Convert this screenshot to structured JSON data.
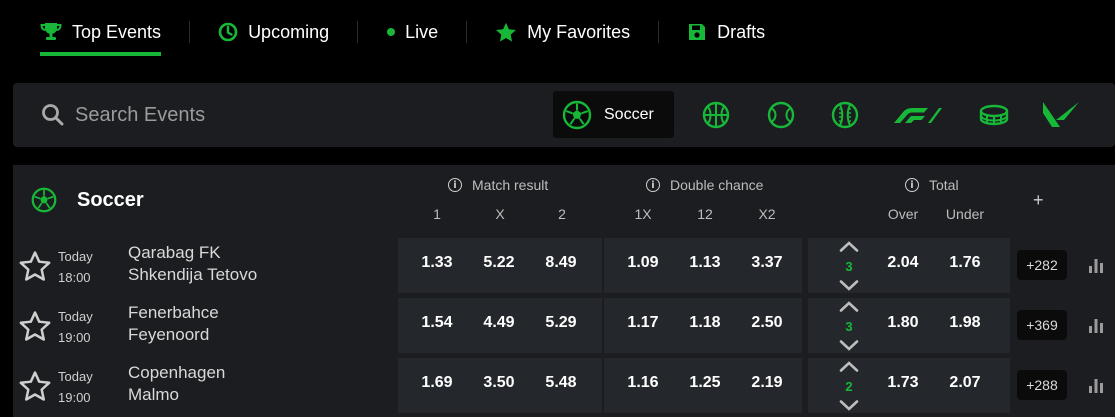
{
  "colors": {
    "accent": "#17b737",
    "panel": "#1b1d20",
    "odds_cell": "#24282c",
    "background": "#000000"
  },
  "nav": {
    "items": [
      {
        "label": "Top Events",
        "icon": "trophy-icon",
        "active": true
      },
      {
        "label": "Upcoming",
        "icon": "clock-icon"
      },
      {
        "label": "Live",
        "icon": "live-dot-icon"
      },
      {
        "label": "My Favorites",
        "icon": "star-icon"
      },
      {
        "label": "Drafts",
        "icon": "save-icon"
      }
    ]
  },
  "search": {
    "placeholder": "Search Events"
  },
  "sports": [
    {
      "label": "Soccer",
      "icon": "soccer-ball-icon",
      "active": true
    },
    {
      "icon": "basketball-icon"
    },
    {
      "icon": "tennis-ball-icon"
    },
    {
      "icon": "baseball-icon"
    },
    {
      "icon": "formula-1-icon"
    },
    {
      "icon": "boxing-ring-icon"
    },
    {
      "icon": "valorant-icon"
    }
  ],
  "table": {
    "sport": "Soccer",
    "groups": {
      "match_result": {
        "title": "Match result",
        "cols": [
          "1",
          "X",
          "2"
        ]
      },
      "double_chance": {
        "title": "Double chance",
        "cols": [
          "1X",
          "12",
          "X2"
        ]
      },
      "total": {
        "title": "Total",
        "cols": [
          "Over",
          "Under"
        ]
      }
    },
    "add_market": "+",
    "events": [
      {
        "day": "Today",
        "time": "18:00",
        "home": "Qarabag FK",
        "away": "Shkendija Tetovo",
        "match_result": [
          "1.33",
          "5.22",
          "8.49"
        ],
        "double_chance": [
          "1.09",
          "1.13",
          "3.37"
        ],
        "total_line": "3",
        "total": [
          "2.04",
          "1.76"
        ],
        "more": "+282"
      },
      {
        "day": "Today",
        "time": "19:00",
        "home": "Fenerbahce",
        "away": "Feyenoord",
        "match_result": [
          "1.54",
          "4.49",
          "5.29"
        ],
        "double_chance": [
          "1.17",
          "1.18",
          "2.50"
        ],
        "total_line": "3",
        "total": [
          "1.80",
          "1.98"
        ],
        "more": "+369"
      },
      {
        "day": "Today",
        "time": "19:00",
        "home": "Copenhagen",
        "away": "Malmo",
        "match_result": [
          "1.69",
          "3.50",
          "5.48"
        ],
        "double_chance": [
          "1.16",
          "1.25",
          "2.19"
        ],
        "total_line": "2",
        "total": [
          "1.73",
          "2.07"
        ],
        "more": "+288"
      }
    ]
  }
}
